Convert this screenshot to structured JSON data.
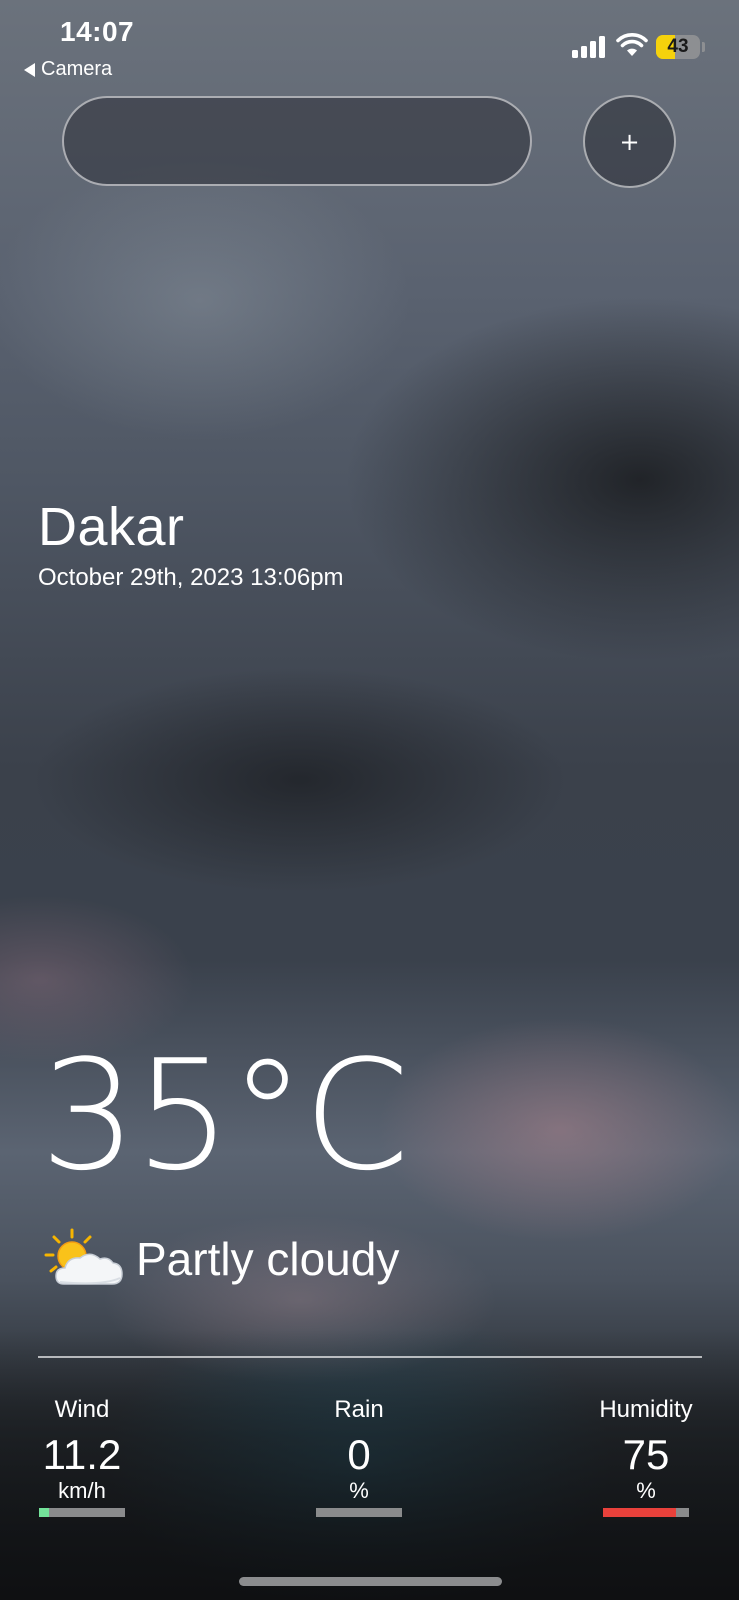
{
  "status_bar": {
    "time": "14:07",
    "back_app": "Camera",
    "battery_level": "43",
    "battery_percent": 43,
    "battery_color": "#f5d20c"
  },
  "search": {
    "value": "",
    "placeholder": ""
  },
  "add_button_label": "+",
  "location": {
    "city": "Dakar",
    "datetime": "October 29th, 2023 13:06pm"
  },
  "current": {
    "temperature": "35°C",
    "condition": "Partly cloudy",
    "condition_icon": "partly-cloudy-icon"
  },
  "stats": [
    {
      "label": "Wind",
      "value": "11.2",
      "unit": "km/h",
      "level": 0.12,
      "color": "#74e39a"
    },
    {
      "label": "Rain",
      "value": "0",
      "unit": "%",
      "level": 0,
      "color": "#e8413b"
    },
    {
      "label": "Humidity",
      "value": "75",
      "unit": "%",
      "level": 0.85,
      "color": "#e8413b"
    }
  ]
}
